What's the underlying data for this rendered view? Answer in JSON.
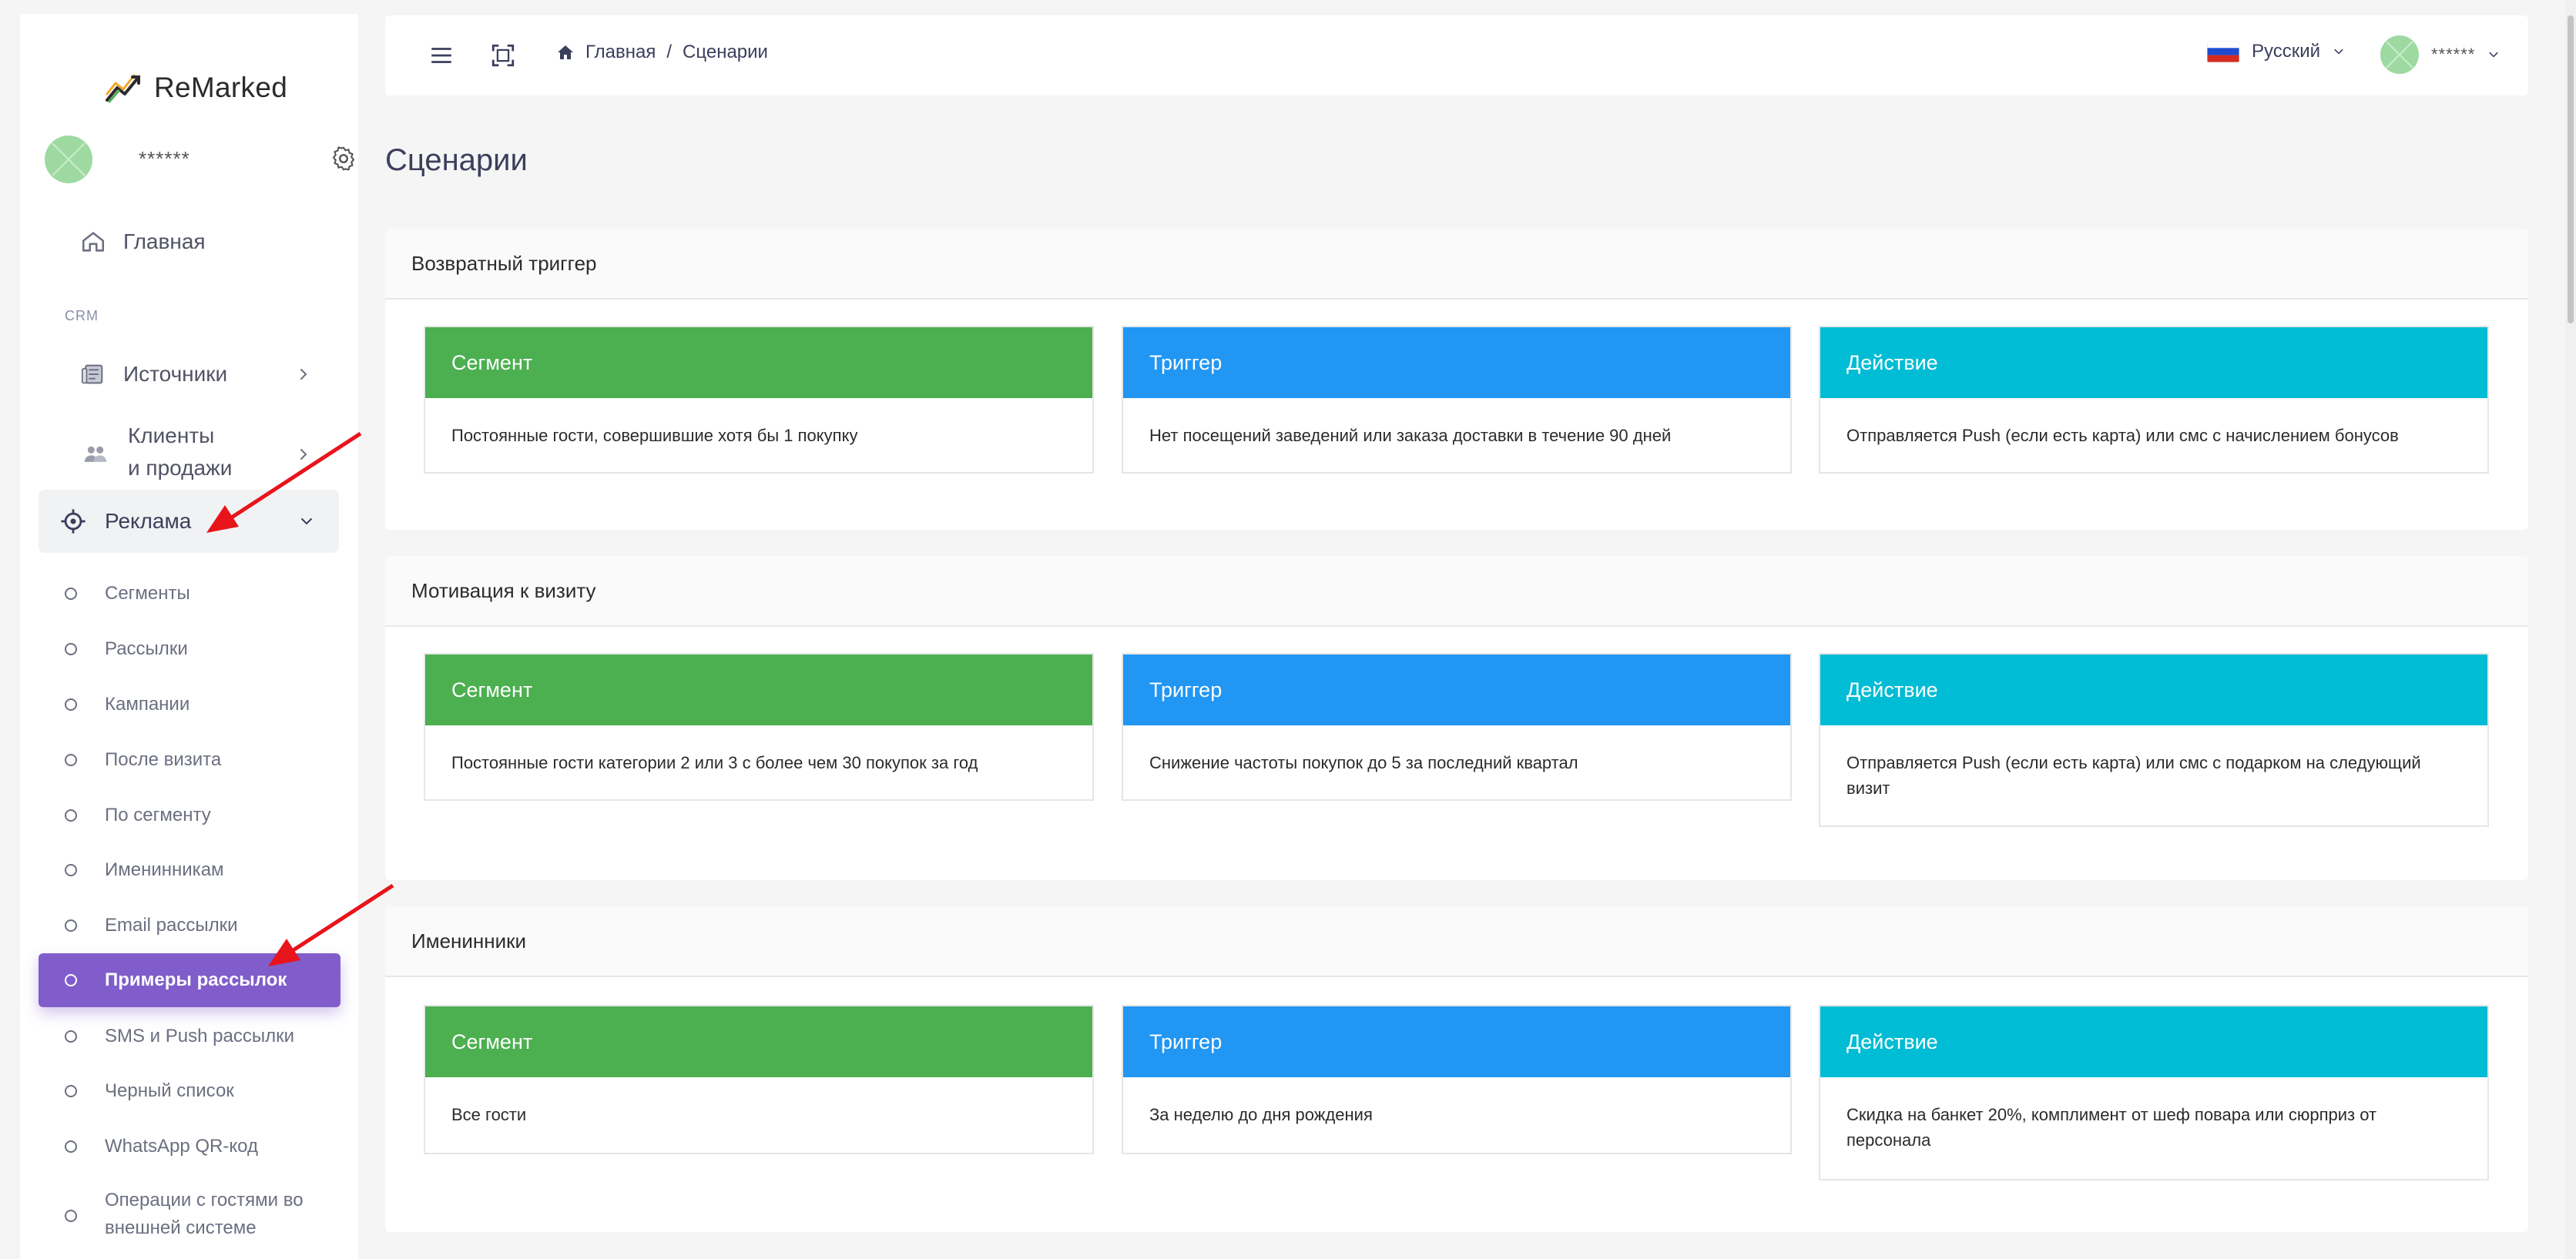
{
  "brand": {
    "name": "ReMarked"
  },
  "profile": {
    "name": "******"
  },
  "sidebar": {
    "home_label": "Главная",
    "section_crm": "CRM",
    "sources_label": "Источники",
    "clients_label_1": "Клиенты",
    "clients_label_2": "и продажи",
    "ads_label": "Реклама",
    "sub_items": [
      "Сегменты",
      "Рассылки",
      "Кампании",
      "После визита",
      "По сегменту",
      "Именинникам",
      "Email рассылки",
      "Примеры рассылок",
      "SMS и Push рассылки",
      "Черный список",
      "WhatsApp QR-код",
      "Операции с гостями во",
      "внешней системе"
    ],
    "active_item": "Примеры рассылок"
  },
  "header": {
    "breadcrumb_home": "Главная",
    "breadcrumb_sep": "/",
    "breadcrumb_current": "Сценарии",
    "language": "Русский",
    "user_name": "******"
  },
  "page": {
    "title": "Сценарии"
  },
  "scenarios": [
    {
      "title": "Возвратный триггер",
      "segment_label": "Сегмент",
      "segment_text": "Постоянные гости, совершившие хотя бы 1 покупку",
      "trigger_label": "Триггер",
      "trigger_text": "Нет посещений заведений или заказа доставки в течение 90 дней",
      "action_label": "Действие",
      "action_text": "Отправляется Push (если есть карта) или смс с начислением бонусов"
    },
    {
      "title": "Мотивация к визиту",
      "segment_label": "Сегмент",
      "segment_text": "Постоянные гости категории 2 или 3 с более чем 30 покупок за год",
      "trigger_label": "Триггер",
      "trigger_text": "Снижение частоты покупок до 5 за последний квартал",
      "action_label": "Действие",
      "action_text": "Отправляется Push (если есть карта) или смс с подарком на следующий визит"
    },
    {
      "title": "Именинники",
      "segment_label": "Сегмент",
      "segment_text": "Все гости",
      "trigger_label": "Триггер",
      "trigger_text": "За неделю до дня рождения",
      "action_label": "Действие",
      "action_text": "Скидка на банкет 20%, комплимент от шеф повара или сюрприз от персонала"
    }
  ],
  "colors": {
    "segment": "#4caf50",
    "trigger": "#2196f3",
    "action": "#00bcd4",
    "active_menu": "#805dca",
    "annotation": "#e8141c"
  },
  "icons": {
    "logo": "chart-trend-icon",
    "settings": "gear-icon",
    "home": "home-icon",
    "sources": "newspaper-icon",
    "clients": "users-icon",
    "ads": "target-icon",
    "menu": "hamburger-icon",
    "fullscreen": "fullscreen-icon",
    "flag": "russia-flag-icon"
  }
}
